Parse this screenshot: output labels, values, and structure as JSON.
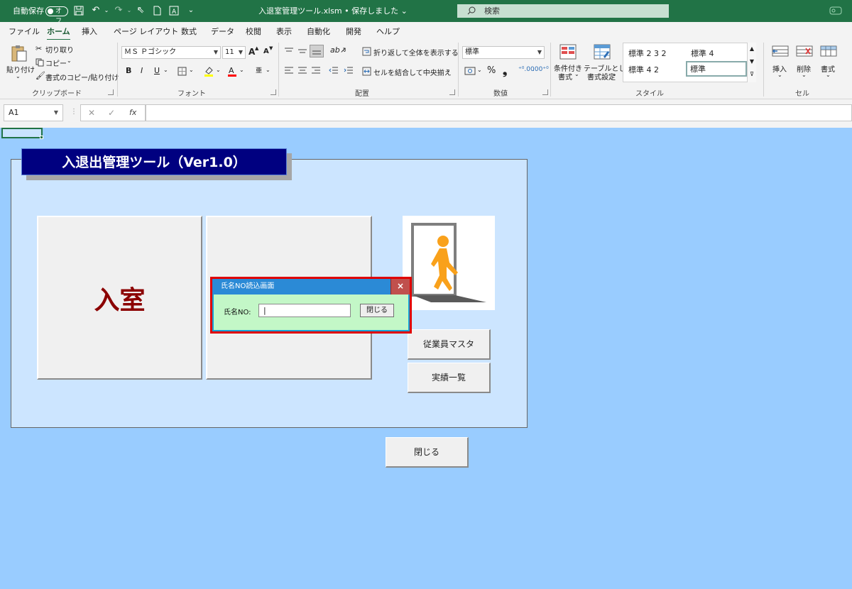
{
  "titlebar": {
    "autosave_label": "自動保存",
    "autosave_state": "オフ",
    "document_title": "入退室管理ツール.xlsm • 保存しました ⌄",
    "search_placeholder": "検索"
  },
  "menu": {
    "tabs": [
      "ファイル",
      "ホーム",
      "挿入",
      "ページ レイアウト",
      "数式",
      "データ",
      "校閲",
      "表示",
      "自動化",
      "開発",
      "ヘルプ"
    ],
    "active_tab": "ホーム"
  },
  "ribbon": {
    "clipboard": {
      "paste": "貼り付け",
      "cut": "切り取り",
      "copy": "コピー",
      "format_painter": "書式のコピー/貼り付け",
      "label": "クリップボード"
    },
    "font": {
      "font_name": "ＭＳ Ｐゴシック",
      "font_size": "11",
      "grow": "A",
      "shrink": "A",
      "bold": "B",
      "italic": "I",
      "underline": "U",
      "label": "フォント"
    },
    "alignment": {
      "wrap_text": "折り返して全体を表示する",
      "merge_center": "セルを結合して中央揃え",
      "label": "配置"
    },
    "number": {
      "format": "標準",
      "percent": "%",
      "comma": "❟",
      "label": "数値"
    },
    "styles": {
      "conditional": "条件付き\n書式",
      "conditional_line1": "条件付き",
      "conditional_line2": "書式",
      "as_table_line1": "テーブルとして",
      "as_table_line2": "書式設定",
      "style_items": [
        "標準 2 3 2",
        "標準 4",
        "標準 4 2",
        "標準"
      ],
      "label": "スタイル"
    },
    "cells": {
      "insert": "挿入",
      "delete": "削除",
      "format": "書式",
      "label": "セル"
    }
  },
  "formula_bar": {
    "name_box": "A1",
    "fx": "fx",
    "value": ""
  },
  "sheet": {
    "background_color": "#99ccff",
    "banner_title": "入退出管理ツール（Ver1.0）",
    "enter_button": "入室",
    "employee_master_button": "従業員マスタ",
    "records_button": "実績一覧",
    "close_button": "閉じる",
    "image": "person-exit-door-icon"
  },
  "dialog": {
    "title": "氏名NO読込画面",
    "close_icon": "×",
    "label": "氏名NO:",
    "input_value": "",
    "close_button": "閉じる"
  }
}
